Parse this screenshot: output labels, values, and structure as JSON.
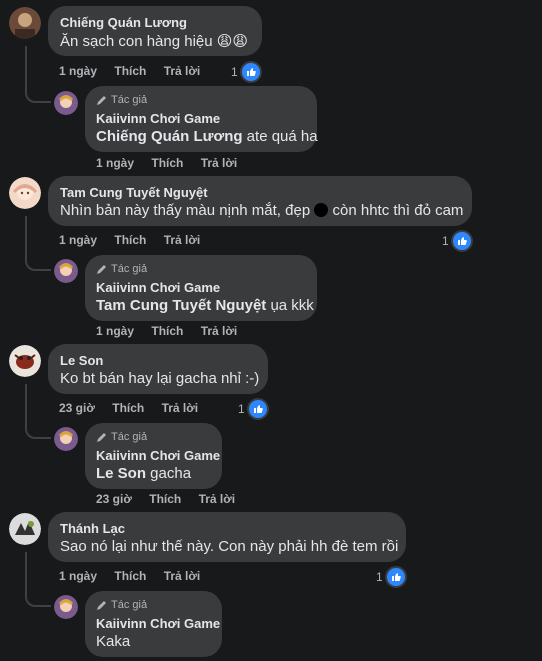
{
  "comments": [
    {
      "author": "Chiếng Quán Lương",
      "text": "Ăn sạch con hàng hiệu",
      "emoji": "😩😩",
      "time": "1 ngày",
      "like_label": "Thích",
      "reply_label": "Trả lời",
      "like_count": "1",
      "reply": {
        "author_badge": "Tác giả",
        "author": "Kaiivinn Chơi Game",
        "mention": "Chiếng Quán Lương",
        "text": " ate quá ha",
        "time": "1 ngày",
        "like_label": "Thích",
        "reply_label": "Trả lời"
      }
    },
    {
      "author": "Tam Cung Tuyết Nguyệt",
      "text": "Nhìn bản này thấy màu nịnh mắt, đẹp",
      "text2": "còn hhtc thì đỏ cam",
      "time": "1 ngày",
      "like_label": "Thích",
      "reply_label": "Trả lời",
      "like_count": "1",
      "reply": {
        "author_badge": "Tác giả",
        "author": "Kaiivinn Chơi Game",
        "mention": "Tam Cung Tuyết Nguyệt",
        "text": " ụa kkk",
        "time": "1 ngày",
        "like_label": "Thích",
        "reply_label": "Trả lời"
      }
    },
    {
      "author": "Le Son",
      "text": "Ko bt bán hay lại gacha nhỉ :-)",
      "time": "23 giờ",
      "like_label": "Thích",
      "reply_label": "Trả lời",
      "like_count": "1",
      "reply": {
        "author_badge": "Tác giả",
        "author": "Kaiivinn Chơi Game",
        "mention": "Le Son",
        "text": " gacha",
        "time": "23 giờ",
        "like_label": "Thích",
        "reply_label": "Trả lời"
      }
    },
    {
      "author": "Thánh Lạc",
      "text": "Sao nó lại như thế này. Con này phải hh đè tem rồi",
      "time": "1 ngày",
      "like_label": "Thích",
      "reply_label": "Trả lời",
      "like_count": "1",
      "reply": {
        "author_badge": "Tác giả",
        "author": "Kaiivinn Chơi Game",
        "mention": "",
        "text": "Kaka"
      }
    }
  ],
  "colors": {
    "background": "#18191a",
    "bubble": "#3a3b3c",
    "like_blue": "#2d88ff",
    "secondary_text": "#b0b3b8"
  }
}
